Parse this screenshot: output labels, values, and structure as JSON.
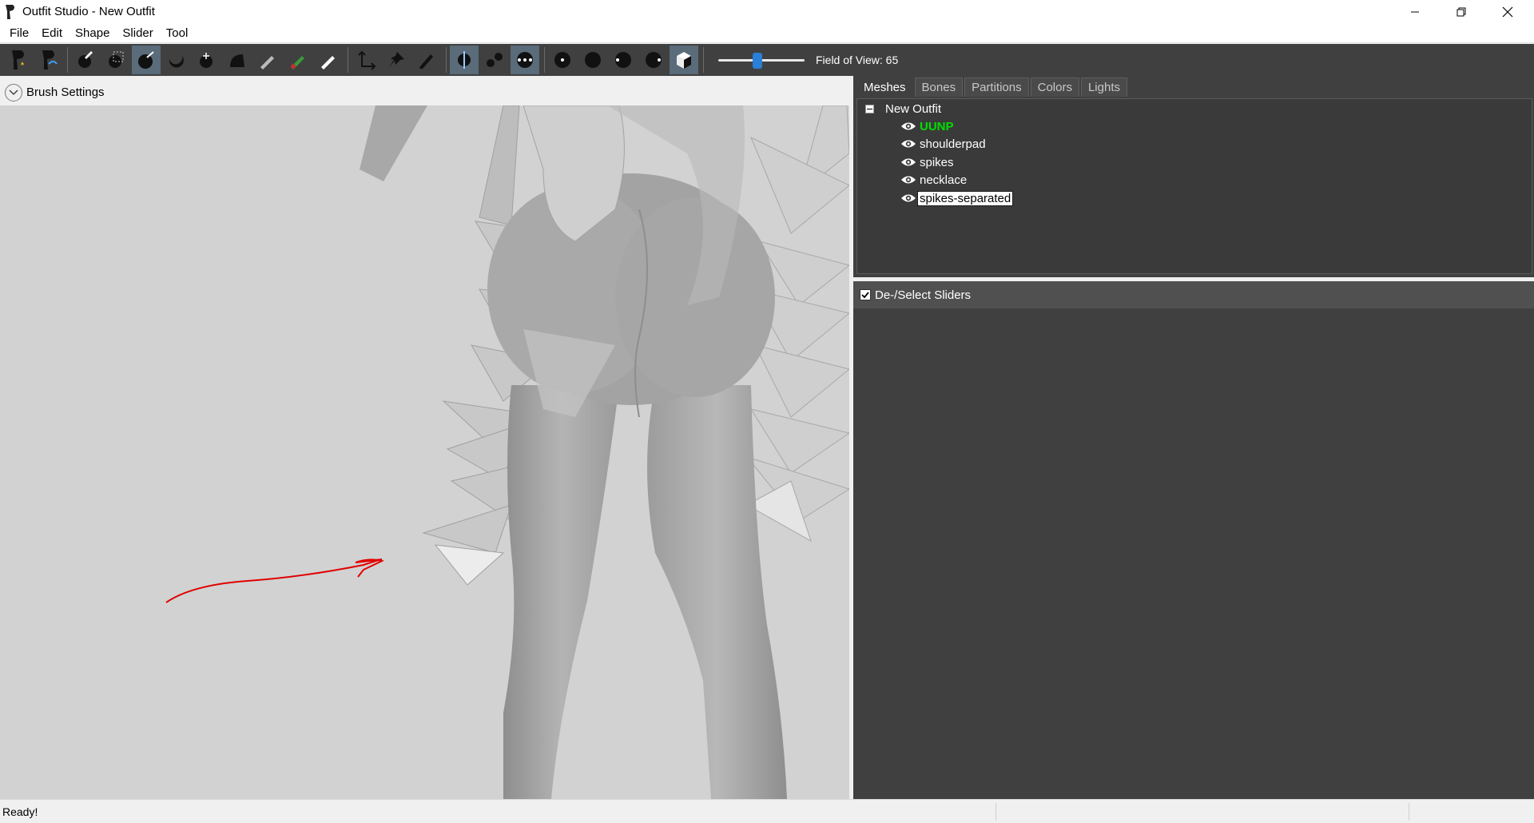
{
  "window": {
    "title": "Outfit Studio - New Outfit"
  },
  "menu": [
    "File",
    "Edit",
    "Shape",
    "Slider",
    "Tool"
  ],
  "toolbar": {
    "field_of_view_label": "Field of View: 65",
    "field_of_view_value": 65,
    "slider_fraction": 0.45,
    "accent_color": "#2a7fd6"
  },
  "left_pane": {
    "brush_settings_label": "Brush Settings"
  },
  "right_pane": {
    "tabs": [
      "Meshes",
      "Bones",
      "Partitions",
      "Colors",
      "Lights"
    ],
    "active_tab": "Meshes",
    "tree": {
      "root": "New Outfit",
      "meshes": [
        {
          "name": "UUNP",
          "reference": true,
          "color": "#00e000"
        },
        {
          "name": "shoulderpad"
        },
        {
          "name": "spikes"
        },
        {
          "name": "necklace"
        },
        {
          "name": "spikes-separated",
          "selected": true
        }
      ]
    },
    "slider_panel": {
      "deselect_label": "De-/Select Sliders",
      "checked": true
    }
  },
  "status": {
    "text": "Ready!"
  }
}
